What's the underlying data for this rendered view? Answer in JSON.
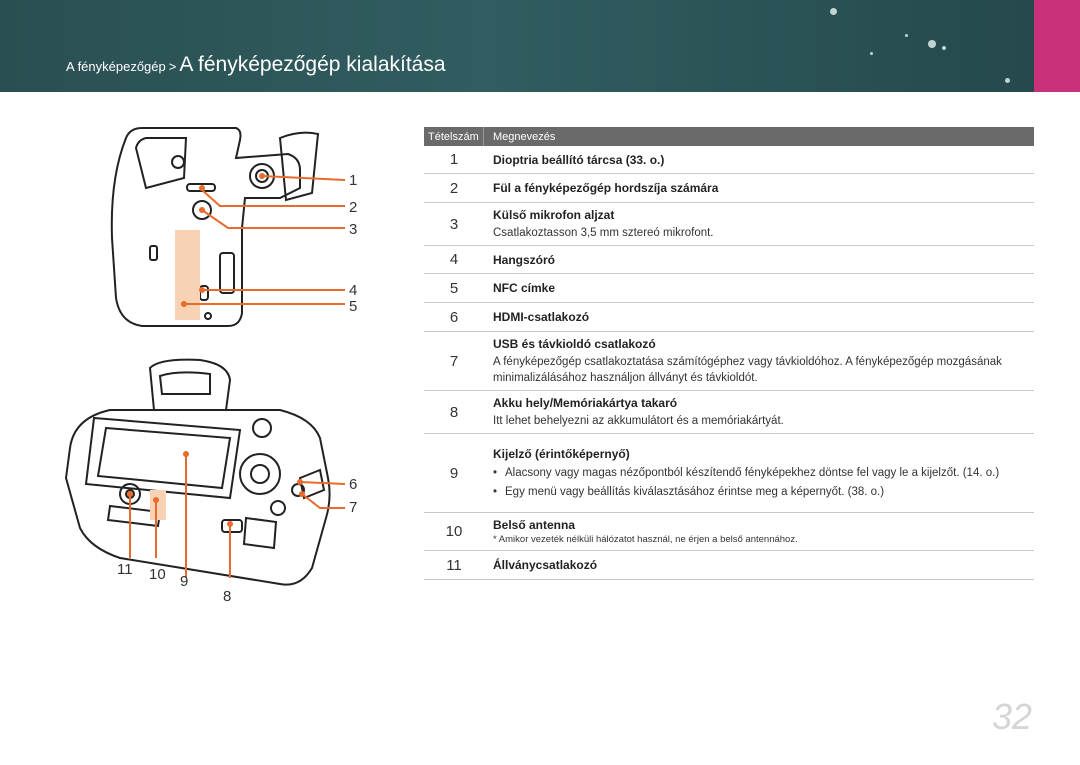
{
  "header": {
    "breadcrumb_parent": "A fényképezőgép",
    "breadcrumb_sep": ">",
    "title": "A fényképezőgép kialakítása",
    "accent_color": "#c9327a",
    "bar_color": "#2f5a5d"
  },
  "callouts": [
    "1",
    "2",
    "3",
    "4",
    "5",
    "6",
    "7",
    "8",
    "9",
    "10",
    "11"
  ],
  "table": {
    "col_num": "Tételszám",
    "col_name": "Megnevezés",
    "rows": [
      {
        "num": "1",
        "title": "Dioptria beállító tárcsa (33. o.)"
      },
      {
        "num": "2",
        "title": "Fül a fényképezőgép hordszíja számára"
      },
      {
        "num": "3",
        "title": "Külső mikrofon aljzat",
        "sub": "Csatlakoztasson 3,5 mm sztereó mikrofont."
      },
      {
        "num": "4",
        "title": "Hangszóró"
      },
      {
        "num": "5",
        "title": "NFC címke"
      },
      {
        "num": "6",
        "title": "HDMI-csatlakozó"
      },
      {
        "num": "7",
        "title": "USB és távkioldó csatlakozó",
        "sub": "A fényképezőgép csatlakoztatása számítógéphez vagy távkioldóhoz. A fényképezőgép mozgásának minimalizálásához használjon állványt és távkioldót."
      },
      {
        "num": "8",
        "title": "Akku hely/Memóriakártya takaró",
        "sub": "Itt lehet behelyezni az akkumulátort és a memóriakártyát."
      },
      {
        "num": "9",
        "title": "Kijelző (érintőképernyő)",
        "bullets": [
          "Alacsony vagy magas nézőpontból készítendő fényképekhez döntse fel vagy le a kijelzőt. (14. o.)",
          "Egy menü vagy beállítás kiválasztásához érintse meg a képernyőt. (38. o.)"
        ]
      },
      {
        "num": "10",
        "title": "Belső antenna",
        "note": "* Amikor vezeték nélküli hálózatot használ, ne érjen a belső antennához."
      },
      {
        "num": "11",
        "title": "Állványcsatlakozó"
      }
    ]
  },
  "page_number": "32"
}
